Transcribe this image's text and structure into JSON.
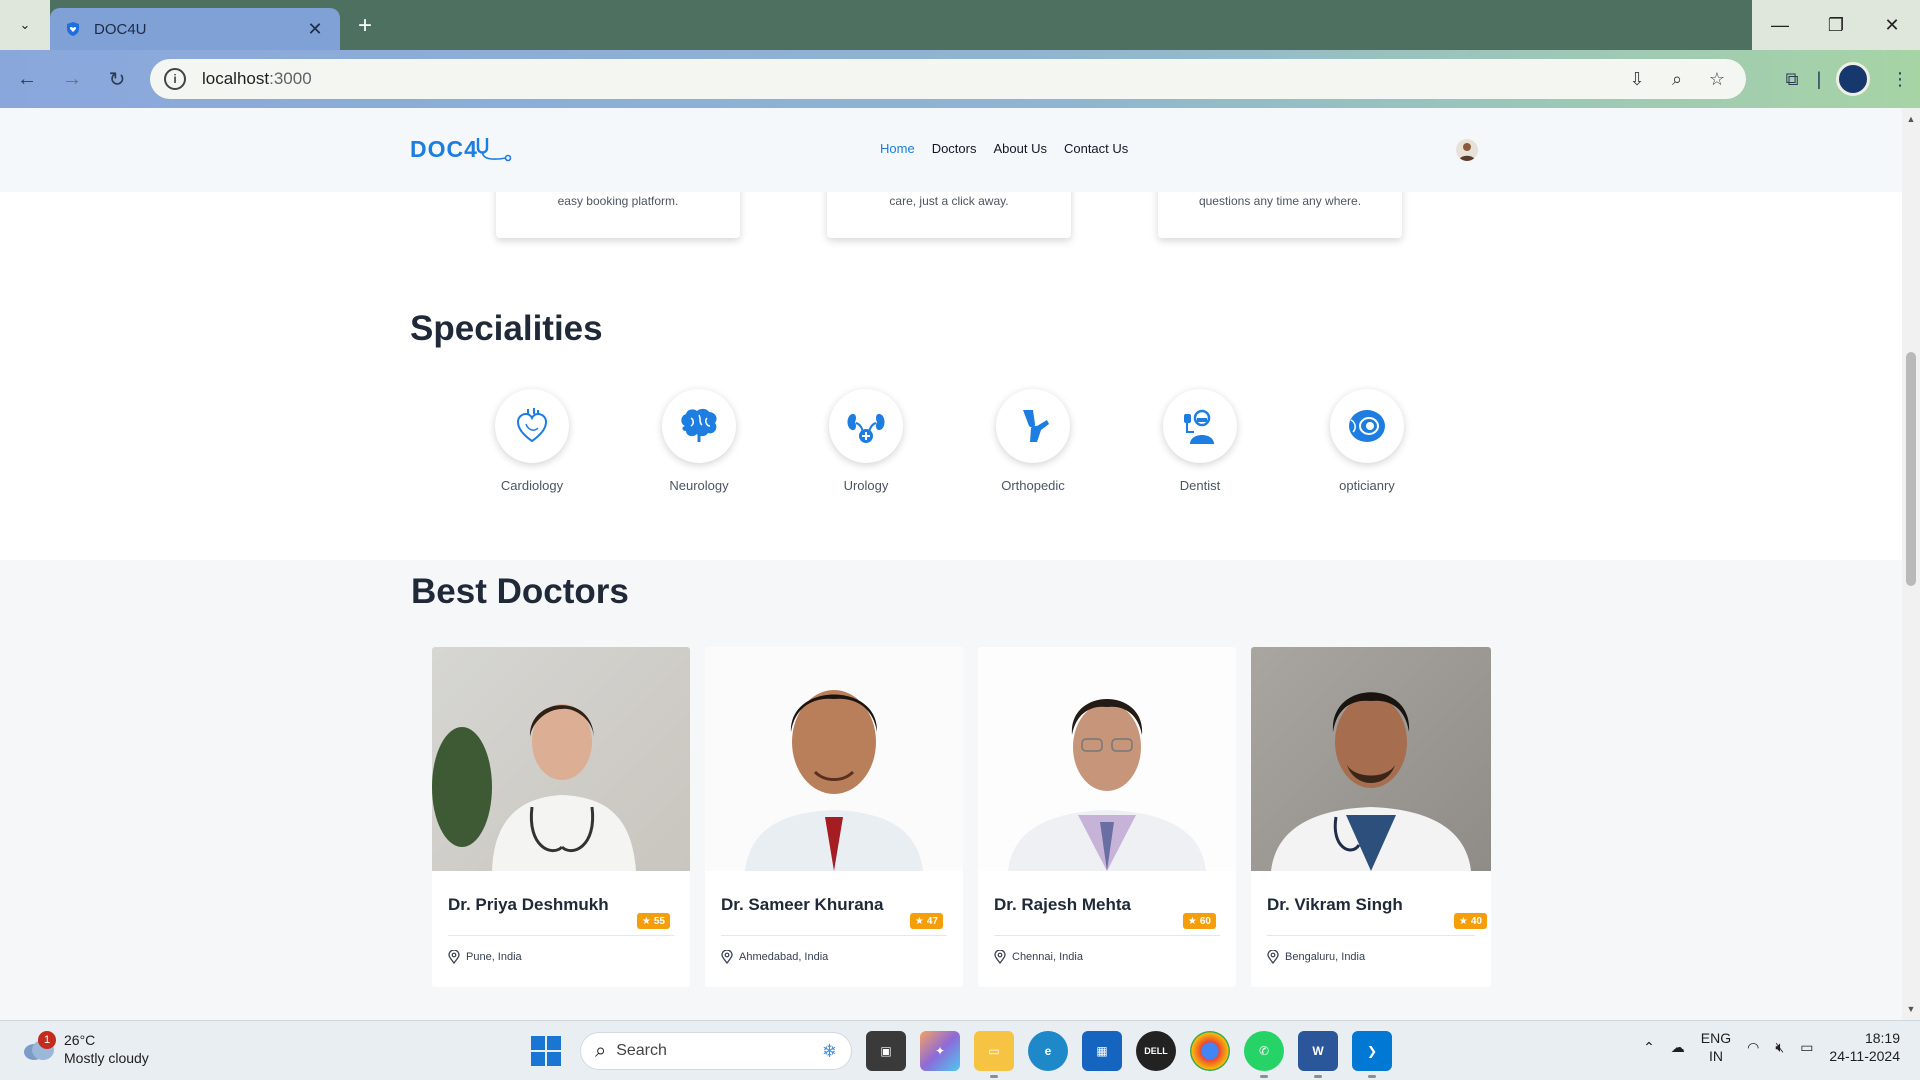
{
  "browser": {
    "tab_title": "DOC4U",
    "tab_close": "✕",
    "new_tab": "+",
    "url_host": "localhost",
    "url_port": ":3000",
    "window_controls": {
      "minimize": "—",
      "restore": "❐",
      "close": "✕"
    }
  },
  "site": {
    "logo": "DOC4",
    "nav": [
      {
        "label": "Home",
        "active": true
      },
      {
        "label": "Doctors",
        "active": false
      },
      {
        "label": "About Us",
        "active": false
      },
      {
        "label": "Contact Us",
        "active": false
      }
    ]
  },
  "features": [
    {
      "text": "easy booking platform."
    },
    {
      "text": "care, just a click away."
    },
    {
      "text": "questions any time any where."
    }
  ],
  "specialities": {
    "title": "Specialities",
    "items": [
      {
        "label": "Cardiology",
        "icon": "heart-icon"
      },
      {
        "label": "Neurology",
        "icon": "brain-icon"
      },
      {
        "label": "Urology",
        "icon": "kidney-icon"
      },
      {
        "label": "Orthopedic",
        "icon": "bone-joint-icon"
      },
      {
        "label": "Dentist",
        "icon": "dentist-icon"
      },
      {
        "label": "opticianry",
        "icon": "eye-icon"
      }
    ]
  },
  "best_doctors": {
    "title": "Best Doctors",
    "doctors": [
      {
        "name": "Dr. Priya Deshmukh",
        "rating": "55",
        "location": "Pune, India"
      },
      {
        "name": "Dr. Sameer Khurana",
        "rating": "47",
        "location": "Ahmedabad, India"
      },
      {
        "name": "Dr. Rajesh Mehta",
        "rating": "60",
        "location": "Chennai, India"
      },
      {
        "name": "Dr. Vikram Singh",
        "rating": "40",
        "location": "Bengaluru, India"
      }
    ]
  },
  "taskbar": {
    "weather_badge": "1",
    "temperature": "26°C",
    "condition": "Mostly cloudy",
    "search_placeholder": "Search",
    "lang_line1": "ENG",
    "lang_line2": "IN",
    "time": "18:19",
    "date": "24-11-2024"
  },
  "colors": {
    "brand": "#1d7de0",
    "rating_badge": "#f59e0b",
    "tab_active": "#7fa1d6"
  }
}
